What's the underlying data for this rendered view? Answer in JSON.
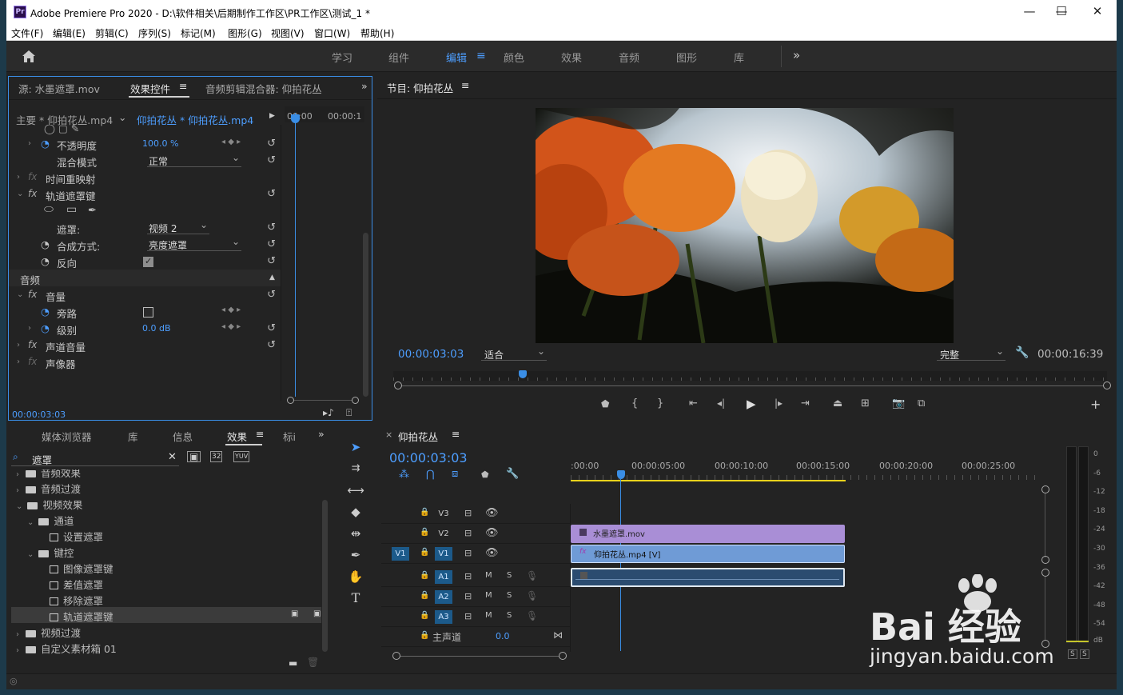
{
  "app": {
    "title": "Adobe Premiere Pro 2020 - D:\\软件相关\\后期制作工作区\\PR工作区\\测试_1 *",
    "logo": "Pr"
  },
  "window_controls": {
    "minimize": "—",
    "maximize": "☐",
    "close": "✕"
  },
  "menu": [
    "文件(F)",
    "编辑(E)",
    "剪辑(C)",
    "序列(S)",
    "标记(M)",
    "图形(G)",
    "视图(V)",
    "窗口(W)",
    "帮助(H)"
  ],
  "workspaces": {
    "items": [
      "学习",
      "组件",
      "编辑",
      "颜色",
      "效果",
      "音频",
      "图形",
      "库"
    ],
    "active": "编辑",
    "more": "»"
  },
  "effect_controls": {
    "tabs": [
      "源: 水墨遮罩.mov",
      "效果控件",
      "音频剪辑混合器: 仰拍花丛"
    ],
    "master": "主要 * 仰拍花丛.mp4",
    "clip": "仰拍花丛 * 仰拍花丛.mp4",
    "ruler": [
      "00:00",
      "00:00:1"
    ],
    "rows": {
      "opacity": {
        "label": "不透明度",
        "value": "100.0 %"
      },
      "blend": {
        "label": "混合模式",
        "value": "正常"
      },
      "time_remap": "时间重映射",
      "track_matte": "轨道遮罩键",
      "matte": {
        "label": "遮罩:",
        "value": "视频 2"
      },
      "composite": {
        "label": "合成方式:",
        "value": "亮度遮罩"
      },
      "reverse": {
        "label": "反向",
        "checked": true
      },
      "audio_header": "音频",
      "volume": "音量",
      "bypass": "旁路",
      "level": {
        "label": "级别",
        "value": "0.0 dB"
      },
      "channel_volume": "声道音量",
      "panner": "声像器"
    },
    "timecode": "00:00:03:03",
    "fx_label": "fx"
  },
  "program": {
    "title": "节目: 仰拍花丛",
    "timecode": "00:00:03:03",
    "fit": "适合",
    "quality": "完整",
    "duration": "00:00:16:39"
  },
  "effects_panel": {
    "tabs": [
      "媒体浏览器",
      "库",
      "信息",
      "效果",
      "标i"
    ],
    "search": "遮罩",
    "tree": [
      {
        "label": "音频效果",
        "level": 0,
        "type": "folder",
        "open": false
      },
      {
        "label": "音频过渡",
        "level": 0,
        "type": "folder",
        "open": false
      },
      {
        "label": "视频效果",
        "level": 0,
        "type": "folder",
        "open": true
      },
      {
        "label": "通道",
        "level": 1,
        "type": "folder",
        "open": true
      },
      {
        "label": "设置遮罩",
        "level": 2,
        "type": "effect"
      },
      {
        "label": "键控",
        "level": 1,
        "type": "folder",
        "open": true
      },
      {
        "label": "图像遮罩键",
        "level": 2,
        "type": "effect"
      },
      {
        "label": "差值遮罩",
        "level": 2,
        "type": "effect"
      },
      {
        "label": "移除遮罩",
        "level": 2,
        "type": "effect"
      },
      {
        "label": "轨道遮罩键",
        "level": 2,
        "type": "effect",
        "selected": true
      },
      {
        "label": "视频过渡",
        "level": 0,
        "type": "folder",
        "open": false
      },
      {
        "label": "自定义素材箱 01",
        "level": 0,
        "type": "folder",
        "open": false
      }
    ]
  },
  "timeline": {
    "sequence": "仰拍花丛",
    "timecode": "00:00:03:03",
    "ruler": [
      ":00:00",
      "00:00:05:00",
      "00:00:10:00",
      "00:00:15:00",
      "00:00:20:00",
      "00:00:25:00"
    ],
    "video_tracks": [
      "V3",
      "V2",
      "V1"
    ],
    "audio_tracks": [
      "A1",
      "A2",
      "A3"
    ],
    "source_patch": "V1",
    "master": {
      "label": "主声道",
      "value": "0.0"
    },
    "clips": {
      "v2": "水墨遮罩.mov",
      "v1": "仰拍花丛.mp4 [V]"
    },
    "ms": {
      "m": "M",
      "s": "S"
    }
  },
  "audio_meter": {
    "scale": [
      "0",
      "-6",
      "-12",
      "-18",
      "-24",
      "-30",
      "-36",
      "-42",
      "-48",
      "-54",
      "dB"
    ],
    "solo": [
      "S",
      "S"
    ]
  },
  "watermark": {
    "brand": "Bai 经验",
    "url": "jingyan.baidu.com"
  },
  "colors": {
    "accent": "#4d9eff",
    "v2clip": "#a98ed6",
    "v1clip": "#6f9bd6",
    "audio": "#2b4c70"
  }
}
